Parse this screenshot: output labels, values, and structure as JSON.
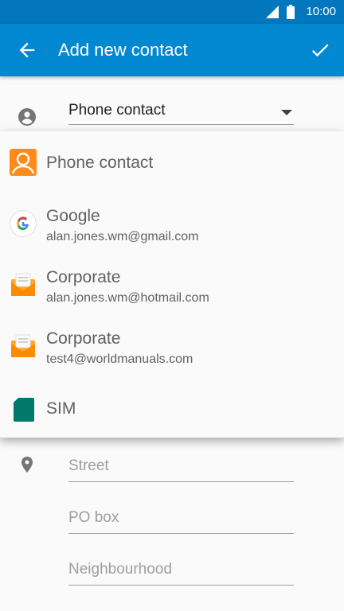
{
  "status_bar": {
    "time": "10:00"
  },
  "app_bar": {
    "title": "Add new contact"
  },
  "account_selector": {
    "value": "Phone contact"
  },
  "address_fields": [
    {
      "placeholder": "Street"
    },
    {
      "placeholder": "PO box"
    },
    {
      "placeholder": "Neighbourhood"
    }
  ],
  "account_menu": {
    "items": [
      {
        "name": "Phone contact",
        "icon": "phone-contact-icon"
      },
      {
        "name": "Google",
        "email": "alan.jones.wm@gmail.com",
        "icon": "google-icon"
      },
      {
        "name": "Corporate",
        "email": "alan.jones.wm@hotmail.com",
        "icon": "email-icon"
      },
      {
        "name": "Corporate",
        "email": "test4@worldmanuals.com",
        "icon": "email-icon"
      },
      {
        "name": "SIM",
        "icon": "sim-card-icon"
      }
    ]
  },
  "colors": {
    "primary": "#0288d1",
    "status_bar": "#0277bd",
    "accent_orange": "#ff8a1a",
    "sim_green": "#00796b"
  }
}
